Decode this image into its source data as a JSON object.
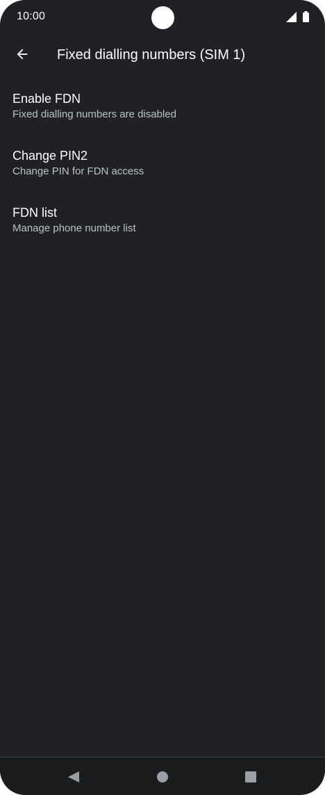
{
  "status_bar": {
    "time": "10:00",
    "icons": [
      "camera-cutout",
      "signal-icon",
      "battery-icon"
    ]
  },
  "app_bar": {
    "back_icon": "arrow-back-icon",
    "title": "Fixed dialling numbers (SIM 1)"
  },
  "preferences": [
    {
      "title": "Enable FDN",
      "summary": "Fixed dialling numbers are disabled"
    },
    {
      "title": "Change PIN2",
      "summary": "Change PIN for FDN access"
    },
    {
      "title": "FDN list",
      "summary": "Manage phone number list"
    }
  ],
  "nav_bar": {
    "icons": [
      "nav-back-icon",
      "nav-home-icon",
      "nav-recents-icon"
    ]
  },
  "colors": {
    "background": "#202124",
    "text_primary": "#ffffff",
    "text_secondary": "#bdc1c6",
    "nav_icon": "#9aa0a6"
  }
}
